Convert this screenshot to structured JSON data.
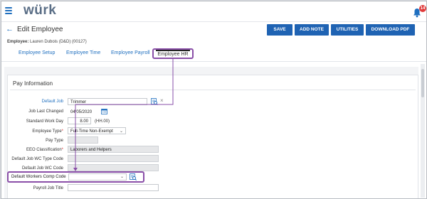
{
  "app": {
    "logo": "würk",
    "notification_count": "14"
  },
  "header": {
    "title": "Edit Employee",
    "employee_prefix": "Employee:",
    "employee_value": "Lauren Dubois (D&D) (00127)"
  },
  "toolbar": {
    "save": "SAVE",
    "add_note": "ADD NOTE",
    "utilities": "UTILITIES",
    "download_pdf": "DOWNLOAD PDF"
  },
  "tabs": [
    {
      "label": "Employee Setup"
    },
    {
      "label": "Employee Time"
    },
    {
      "label": "Employee Payroll"
    },
    {
      "label": "Employee HR"
    }
  ],
  "section": {
    "title": "Pay Information"
  },
  "fields": {
    "default_job": {
      "label": "Default Job",
      "value": "Trimmer"
    },
    "job_last_changed": {
      "label": "Job Last Changed",
      "value": "04/05/2020"
    },
    "standard_work_day": {
      "label": "Standard Work Day",
      "value": "8.00",
      "unit": "(HH.00)"
    },
    "employee_type": {
      "label": "Employee Type",
      "required_mark": "*",
      "value": "Full-Time Non-Exempt"
    },
    "pay_type": {
      "label": "Pay Type",
      "value": ""
    },
    "eeo_classification": {
      "label": "EEO Classification",
      "required_mark": "*",
      "value": "Laborers and Helpers"
    },
    "default_job_wc_type_code": {
      "label": "Default Job WC Type Code",
      "value": ""
    },
    "default_job_wc_code": {
      "label": "Default Job WC Code",
      "value": ""
    },
    "default_workers_comp_code": {
      "label": "Default Workers Comp Code",
      "value": ""
    },
    "payroll_job_title": {
      "label": "Payroll Job Title",
      "value": ""
    }
  },
  "colors": {
    "accent": "#1f63b3",
    "highlight": "#8a4fa8",
    "link": "#1f6fbf",
    "badge": "#e03a3a"
  }
}
